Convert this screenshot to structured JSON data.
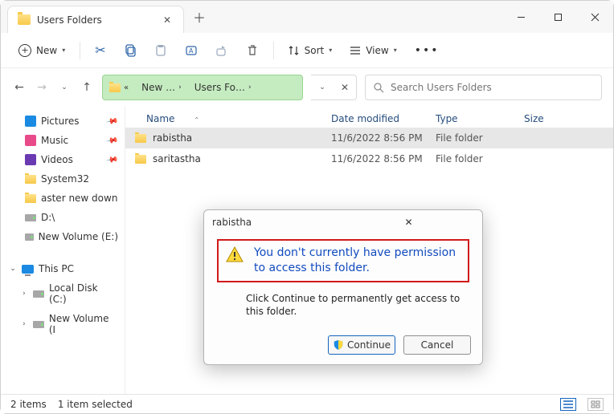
{
  "window": {
    "tab_title": "Users Folders"
  },
  "toolbar": {
    "new_label": "New",
    "sort_label": "Sort",
    "view_label": "View"
  },
  "addressbar": {
    "seg1": "New …",
    "seg2": "Users Fo…"
  },
  "search": {
    "placeholder": "Search Users Folders"
  },
  "sidebar": {
    "items": [
      {
        "label": "Pictures",
        "pinned": true
      },
      {
        "label": "Music",
        "pinned": true
      },
      {
        "label": "Videos",
        "pinned": true
      },
      {
        "label": "System32",
        "pinned": false
      },
      {
        "label": "aster new down",
        "pinned": false
      },
      {
        "label": "D:\\",
        "pinned": false
      },
      {
        "label": "New Volume (E:)",
        "pinned": false
      }
    ],
    "thispc": "This PC",
    "localdisk": "Local Disk (C:)",
    "newvol": "New Volume (I"
  },
  "columns": {
    "name": "Name",
    "date": "Date modified",
    "type": "Type",
    "size": "Size"
  },
  "rows": [
    {
      "name": "rabistha",
      "date": "11/6/2022 8:56 PM",
      "type": "File folder"
    },
    {
      "name": "saritastha",
      "date": "11/6/2022 8:56 PM",
      "type": "File folder"
    }
  ],
  "status": {
    "count": "2 items",
    "selected": "1 item selected"
  },
  "dialog": {
    "title": "rabistha",
    "message": "You don't currently have permission to access this folder.",
    "sub": "Click Continue to permanently get access to this folder.",
    "continue": "Continue",
    "cancel": "Cancel"
  }
}
